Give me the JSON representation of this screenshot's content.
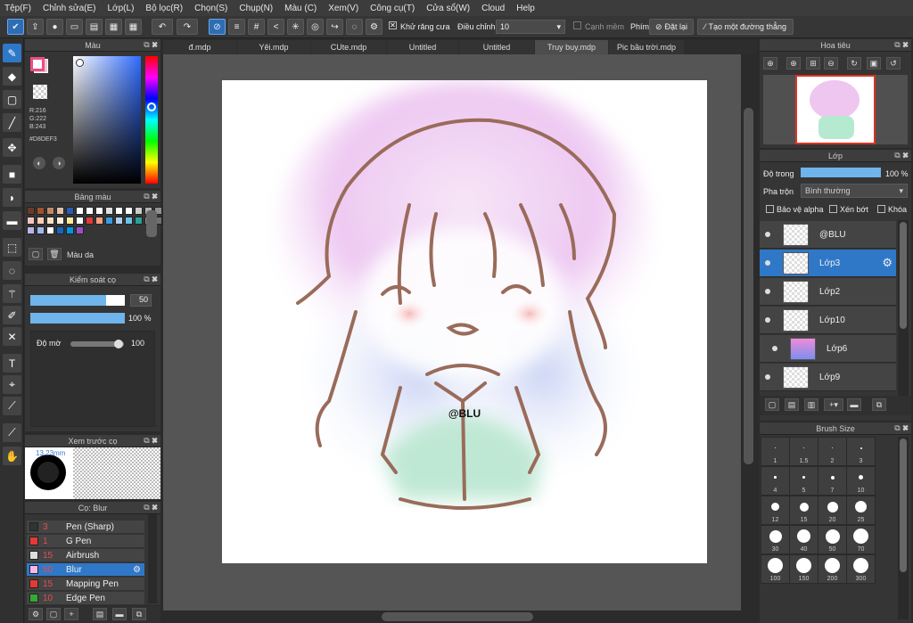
{
  "menu": [
    "Tệp(F)",
    "Chỉnh sửa(E)",
    "Lớp(L)",
    "Bộ lọc(R)",
    "Chọn(S)",
    "Chụp(N)",
    "Màu (C)",
    "Xem(V)",
    "Công cụ(T)",
    "Cửa sổ(W)",
    "Cloud",
    "Help"
  ],
  "toolbar": {
    "antialias": "Khử răng cưa",
    "adjust_label": "Điều chỉnh",
    "adjust_value": "10",
    "soft_edge": "Cạnh mềm",
    "shortcut_label": "Phím",
    "reset": "Đặt lại",
    "line_label": "Tạo một đường thẳng"
  },
  "tabs": [
    "đ.mdp",
    "Yêi.mdp",
    "CUte.mdp",
    "Untitled",
    "Untitled",
    "Truy buy.mdp",
    "Pic bầu trời.mdp"
  ],
  "color_panel": {
    "title": "Màu",
    "r": "R:216",
    "g": "G:222",
    "b": "B:243",
    "hex": "#D8DEF3",
    "fg": "#e94f7f",
    "bg": "#f2c6d8"
  },
  "palette_panel": {
    "title": "Bảng màu",
    "name": "Màu da",
    "colors": [
      "#6b3a2a",
      "#a0522d",
      "#c08a6a",
      "#e0c0a8",
      "#2a5db0",
      "#ffffff",
      "#ffffff",
      "#ffffff",
      "#e0e0e0",
      "#ffffff",
      "#ffffff",
      "#cccccc",
      "#b0b0b0",
      "#909090",
      "#f2c6c0",
      "#f6d0b8",
      "#f9e2c8",
      "#fdf0e0",
      "#ffe9a0",
      "#ffffff",
      "#e53935",
      "#ff9f80",
      "#3a9be0",
      "#b0d0f0",
      "#6bc3e8",
      "#2aa198",
      "#8a8a8a",
      "#707070",
      "#b8b8e8",
      "#a0b8f0",
      "#ffffff",
      "#1565c0",
      "#0097e6",
      "#9c4dcc"
    ]
  },
  "brush_control": {
    "title": "Kiểm soát cọ",
    "size": "50",
    "opacity": "100 %",
    "hardness_label": "Độ mờ",
    "hardness_value": "100",
    "size_fill": 0.8,
    "opacity_fill": 1.0,
    "hardness_fill": 0.9
  },
  "preview": {
    "title": "Xem trước cọ",
    "size_text": "13.23mm"
  },
  "brushes": {
    "title": "Cọ: Blur",
    "items": [
      {
        "num": "3",
        "name": "Pen (Sharp)",
        "color": "#333333"
      },
      {
        "num": "1",
        "name": "G Pen",
        "color": "#e53935"
      },
      {
        "num": "15",
        "name": "Airbrush",
        "color": "#dddddd"
      },
      {
        "num": "50",
        "name": "Blur",
        "color": "#f7b8e8"
      },
      {
        "num": "15",
        "name": "Mapping Pen",
        "color": "#e53935"
      },
      {
        "num": "10",
        "name": "Edge Pen",
        "color": "#33aa33"
      }
    ]
  },
  "navigator": {
    "title": "Hoa tiêu"
  },
  "layers": {
    "title": "Lớp",
    "opacity_label": "Độ trong",
    "opacity_value": "100 %",
    "opacity_fill": 1.0,
    "blend_label": "Pha trộn",
    "blend_value": "Bình thường",
    "protect_alpha": "Bảo vệ alpha",
    "clipping": "Xén bớt",
    "lock": "Khóa",
    "items": [
      {
        "name": "@BLU"
      },
      {
        "name": "Lớp3"
      },
      {
        "name": "Lớp2"
      },
      {
        "name": "Lớp10"
      },
      {
        "name": "Lớp6"
      },
      {
        "name": "Lớp9"
      }
    ]
  },
  "brush_size": {
    "title": "Brush Size",
    "sizes": [
      "1",
      "1.5",
      "2",
      "3",
      "4",
      "5",
      "7",
      "10",
      "12",
      "15",
      "20",
      "25",
      "30",
      "40",
      "50",
      "70",
      "100",
      "150",
      "200",
      "300"
    ]
  },
  "canvas": {
    "signature": "@BLU"
  }
}
